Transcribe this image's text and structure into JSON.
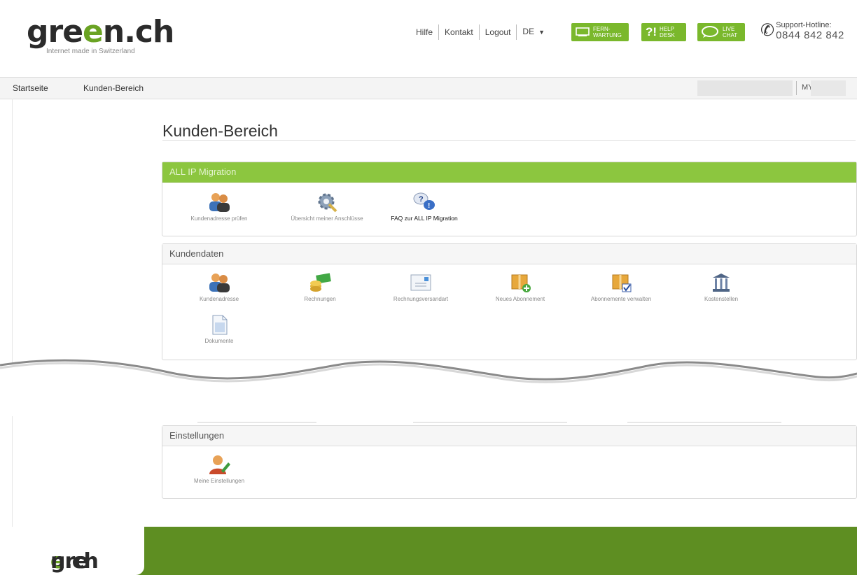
{
  "header": {
    "logo_text_1": "gre",
    "logo_text_e": "e",
    "logo_text_2": "n.ch",
    "logo_tagline": "Internet made in Switzerland",
    "links": [
      "Hilfe",
      "Kontakt",
      "Logout"
    ],
    "language": "DE",
    "fernwartung_label": "FERN- WARTUNG",
    "helpdesk_mark": "?!",
    "helpdesk_label": "HELP DESK",
    "livechat_label": "LIVE CHAT",
    "hotline_label": "Support-Hotline:",
    "hotline_number": "0844 842 842"
  },
  "nav": {
    "items": [
      "Startseite",
      "Kunden-Bereich"
    ],
    "account_prefix": "MY-"
  },
  "page": {
    "title": "Kunden-Bereich"
  },
  "sections": {
    "allip": {
      "title": "ALL IP Migration",
      "tiles": [
        {
          "label": "Kundenadresse prüfen",
          "icon": "users-icon"
        },
        {
          "label": "Übersicht meiner Anschlüsse",
          "icon": "settings-gear-icon"
        },
        {
          "label": "FAQ zur ALL IP Migration",
          "icon": "faq-bubbles-icon"
        }
      ]
    },
    "kundendaten": {
      "title": "Kundendaten",
      "tiles": [
        {
          "label": "Kundenadresse",
          "icon": "users-icon"
        },
        {
          "label": "Rechnungen",
          "icon": "money-icon"
        },
        {
          "label": "Rechnungsversandart",
          "icon": "envelope-icon"
        },
        {
          "label": "Neues Abonnement",
          "icon": "box-add-icon"
        },
        {
          "label": "Abonnemente verwalten",
          "icon": "box-check-icon"
        },
        {
          "label": "Kostenstellen",
          "icon": "bank-icon"
        },
        {
          "label": "Dokumente",
          "icon": "document-icon"
        }
      ]
    },
    "einstellungen": {
      "title": "Einstellungen",
      "tiles": [
        {
          "label": "Meine Einstellungen",
          "icon": "user-edit-icon"
        }
      ]
    }
  },
  "footer": {
    "logo_text_1": "gre",
    "logo_text_e": "e",
    "logo_text_2": "n.ch"
  },
  "colors": {
    "brand_green": "#8cc63f",
    "button_green": "#7ab82c",
    "footer_green": "#5e8e22"
  }
}
